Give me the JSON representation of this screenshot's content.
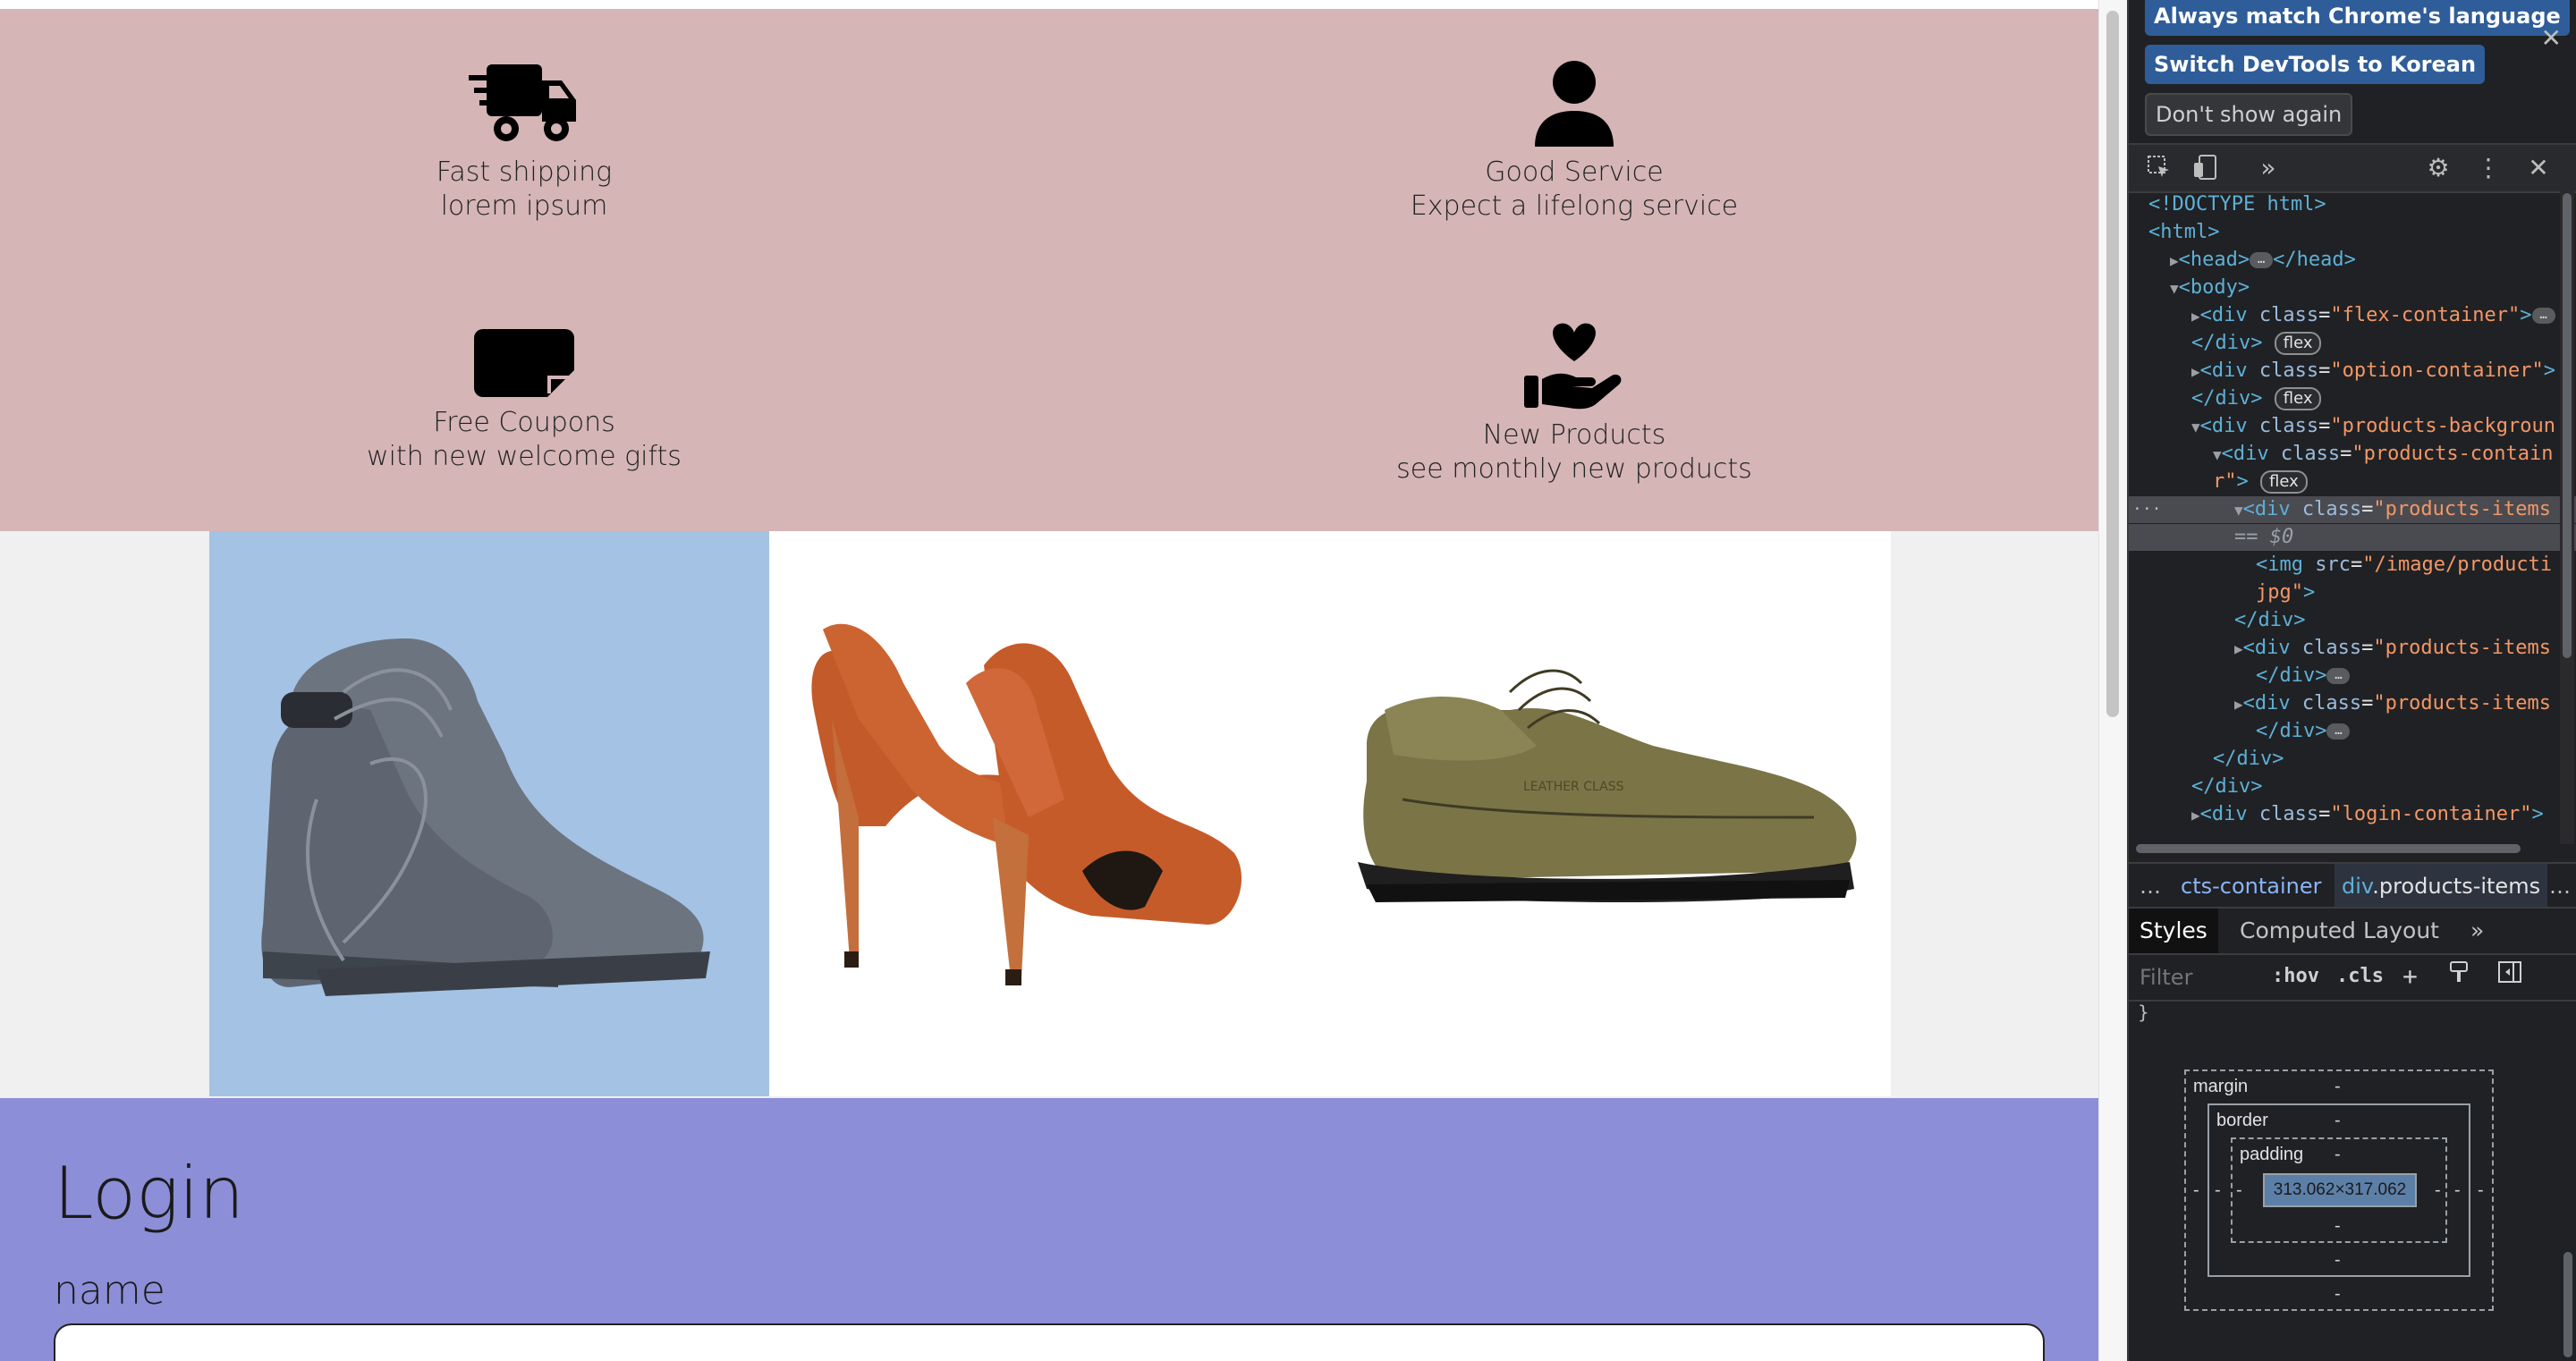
{
  "features": [
    {
      "icon": "delivery-truck-icon",
      "title": "Fast shipping",
      "subtitle": "lorem ipsum"
    },
    {
      "icon": "person-icon",
      "title": "Good Service",
      "subtitle": "Expect a lifelong service"
    },
    {
      "icon": "coupon-ticket-icon",
      "title": "Free Coupons",
      "subtitle": "with new welcome gifts"
    },
    {
      "icon": "heart-hand-icon",
      "title": "New Products",
      "subtitle": "see monthly new products"
    }
  ],
  "products": [
    {
      "name": "gray-boots",
      "color": "#a4c2e4"
    },
    {
      "name": "orange-high-heels",
      "color": "#ffffff"
    },
    {
      "name": "olive-leather-shoe",
      "color": "#ffffff"
    }
  ],
  "login": {
    "title": "Login",
    "name_label": "name",
    "name_value": ""
  },
  "devtools": {
    "notice_buttons": [
      "Always match Chrome's language",
      "Switch DevTools to Korean",
      "Don't show again"
    ],
    "dom_lines": [
      {
        "indent": 0,
        "tri": "",
        "tag": "<!DOCTYPE html>",
        "rest": "",
        "sel": false
      },
      {
        "indent": 0,
        "tri": "",
        "tag": "<html>",
        "rest": "",
        "sel": false
      },
      {
        "indent": 1,
        "tri": "▶",
        "tag": "<head>",
        "rest": "</head>",
        "ell": true,
        "sel": false
      },
      {
        "indent": 1,
        "tri": "▼",
        "tag": "<body>",
        "rest": "",
        "sel": false
      },
      {
        "indent": 2,
        "tri": "▶",
        "tag": "<div",
        "attr": "class",
        "val": "\"flex-container\"",
        "close": ">",
        "ell": true,
        "sel": false
      },
      {
        "indent": 2,
        "tri": "",
        "tag": "</div>",
        "pill": "flex",
        "sel": false
      },
      {
        "indent": 2,
        "tri": "▶",
        "tag": "<div",
        "attr": "class",
        "val": "\"option-container\"",
        "close": ">",
        "sel": false
      },
      {
        "indent": 2,
        "tri": "",
        "tag": "</div>",
        "pill": "flex",
        "sel": false
      },
      {
        "indent": 2,
        "tri": "▼",
        "tag": "<div",
        "attr": "class",
        "val": "\"products-backgroun",
        "close": "",
        "sel": false
      },
      {
        "indent": 3,
        "tri": "▼",
        "tag": "<div",
        "attr": "class",
        "val": "\"products-contain",
        "close": "",
        "sel": false
      },
      {
        "indent": 3,
        "tri": "",
        "tag": "",
        "val": "r\"",
        "close": ">",
        "pill": "flex",
        "sel": false
      },
      {
        "indent": 4,
        "tri": "▼",
        "tag": "<div",
        "attr": "class",
        "val": "\"products-items",
        "close": "",
        "sel": true
      },
      {
        "indent": 4,
        "tri": "",
        "tag": "",
        "dim": "== $0",
        "sel": true
      },
      {
        "indent": 5,
        "tri": "",
        "tag": "<img",
        "attr": "src",
        "val": "\"/image/producti",
        "close": "",
        "sel": false
      },
      {
        "indent": 5,
        "tri": "",
        "tag": "",
        "val": "jpg\"",
        "close": ">",
        "sel": false
      },
      {
        "indent": 4,
        "tri": "",
        "tag": "</div>",
        "sel": false
      },
      {
        "indent": 4,
        "tri": "▶",
        "tag": "<div",
        "attr": "class",
        "val": "\"products-items",
        "close": "",
        "sel": false
      },
      {
        "indent": 5,
        "tri": "",
        "tag": "</div>",
        "ell": true,
        "sel": false
      },
      {
        "indent": 4,
        "tri": "▶",
        "tag": "<div",
        "attr": "class",
        "val": "\"products-items",
        "close": "",
        "sel": false
      },
      {
        "indent": 5,
        "tri": "",
        "tag": "</div>",
        "ell": true,
        "sel": false
      },
      {
        "indent": 3,
        "tri": "",
        "tag": "</div>",
        "sel": false
      },
      {
        "indent": 2,
        "tri": "",
        "tag": "</div>",
        "sel": false
      },
      {
        "indent": 2,
        "tri": "▶",
        "tag": "<div",
        "attr": "class",
        "val": "\"login-container\"",
        "close": ">",
        "sel": false
      }
    ],
    "breadcrumb": {
      "first": "cts-container",
      "second_tag": "div",
      "second_class": ".products-items"
    },
    "tabs": [
      "Styles",
      "Computed",
      "Layout"
    ],
    "filter_placeholder": "Filter",
    "hov_label": ":hov",
    "cls_label": ".cls",
    "box_model": {
      "margin_label": "margin",
      "border_label": "border",
      "padding_label": "padding",
      "dash": "-",
      "content_size": "313.062×317.062"
    }
  }
}
